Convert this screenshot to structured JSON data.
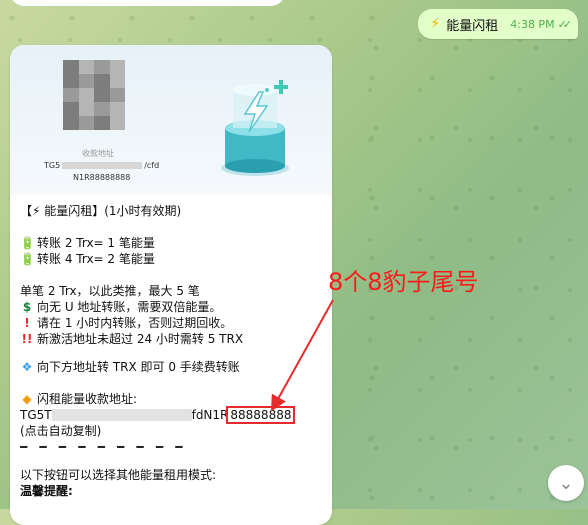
{
  "sent_message": {
    "icon": "lightning-icon",
    "text": "能量闪租",
    "time": "4:38 PM",
    "status_icon": "double-check-icon"
  },
  "banner": {
    "address_label": "收款地址",
    "address_prefix": "TG5",
    "address_suffix": "/cfd",
    "address_number": "N1R88888888"
  },
  "message": {
    "header": "【⚡ 能量闪租】(1小时有效期)",
    "rate_line_1": "转账  2 Trx=  1 笔能量",
    "rate_line_2": "转账  4 Trx=  2 笔能量",
    "info_1": "单笔  2 Trx，以此类推，最大 5 笔",
    "info_2": "向无 U 地址转账，需要双倍能量。",
    "info_3": "请在 1 小时内转账，否则过期回收。",
    "info_4": "新激活地址未超过 24 小时需转 5 TRX",
    "transfer_note": "向下方地址转 TRX 即可 0 手续费转账",
    "receive_title": "闪租能量收款地址:",
    "address_start": "TG5T",
    "address_mid": "fdN1R",
    "address_highlight": "88888888",
    "copy_hint": "(点击自动复制)",
    "divider": "━ ━ ━ ━ ━ ━ ━ ━ ━",
    "more_modes": "以下按钮可以选择其他能量租用模式:",
    "tips_title": "温馨提醒:"
  },
  "annotation": {
    "text": "8个8豹子尾号",
    "color": "#ff1a1a"
  },
  "colors": {
    "sent_bubble": "#e2fec9",
    "time_green": "#4fae4e",
    "highlight_red": "#e52b2b"
  }
}
